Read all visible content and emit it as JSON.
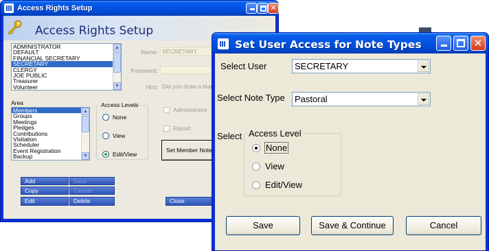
{
  "back_window": {
    "title": "Access Rights Setup",
    "header_title": "Access Rights Setup",
    "users": [
      "ADMINISTRATOR",
      "DEFAULT",
      "FINANCIAL SECRETARY",
      "SECRETARY",
      "CLERGY",
      "JOE PUBLIC",
      "Treasurer",
      "Volunteer"
    ],
    "selected_user_index": 3,
    "name_label": "Name:",
    "name_value": "SECRETARY",
    "password_label": "Password:",
    "hint_label": "Hint:",
    "hint_value": "Did you draw a blan",
    "area_label": "Area",
    "areas": [
      "Members",
      "Groups",
      "Meetings",
      "Pledges",
      "Contributions",
      "Visitation",
      "Scheduler",
      "Event Registration",
      "Backup"
    ],
    "selected_area_index": 0,
    "access_levels": {
      "legend": "Access Levels",
      "options": [
        "None",
        "View",
        "Edit/View"
      ],
      "selected": "Edit/View"
    },
    "administrator_label": "Administrator",
    "report_label": "Report",
    "set_member_notes_label": "Set Member Notes",
    "buttons": {
      "add": "Add",
      "save": "Save",
      "copy": "Copy",
      "cancel": "Cancel",
      "edit": "Edit",
      "delete": "Delete",
      "close": "Close"
    }
  },
  "front_window": {
    "title": "Set User Access for Note Types",
    "select_user_label": "Select User",
    "select_user_value": "SECRETARY",
    "select_note_type_label": "Select Note Type",
    "select_note_type_value": "Pastoral",
    "select_label": "Select",
    "access_level_legend": "Access Level",
    "options": [
      "None",
      "View",
      "Edit/View"
    ],
    "selected": "None",
    "buttons": {
      "save": "Save",
      "save_continue": "Save & Continue",
      "cancel": "Cancel"
    }
  },
  "colors": {
    "xp_title_blue": "#0054e3",
    "xp_close_red": "#d83a17",
    "selection_blue": "#316ac5",
    "dialog_face": "#ece9d8"
  },
  "icons": [
    "app-icon",
    "key-icon",
    "minimize-icon",
    "maximize-icon",
    "close-icon",
    "dropdown-arrow-icon"
  ]
}
